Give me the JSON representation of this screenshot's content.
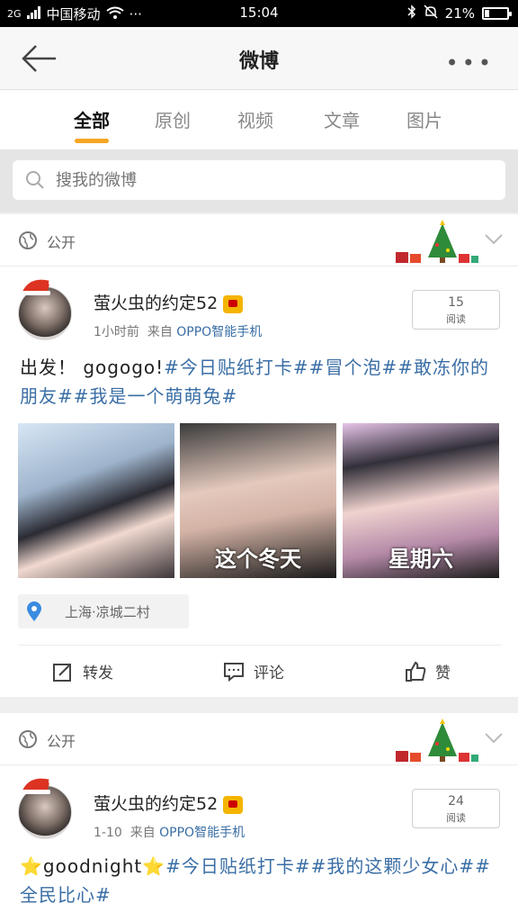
{
  "statusbar": {
    "carrier": "中国移动",
    "signal_label": "2G",
    "time": "15:04",
    "battery": "21%"
  },
  "header": {
    "title": "微博"
  },
  "tabs": [
    {
      "label": "全部",
      "active": true
    },
    {
      "label": "原创"
    },
    {
      "label": "视频"
    },
    {
      "label": "文章"
    },
    {
      "label": "图片"
    }
  ],
  "search": {
    "placeholder": "搜我的微博"
  },
  "posts": [
    {
      "privacy": "公开",
      "username": "萤火虫的约定52",
      "time": "1小时前",
      "source_prefix": "来自",
      "source": "OPPO智能手机",
      "reads_count": "15",
      "reads_label": "阅读",
      "text_plain": "出发！ gogogo!",
      "text_tags": "#今日贴纸打卡##冒个泡##敢冻你的朋友##我是一个萌萌兔#",
      "photos": [
        {
          "caption": ""
        },
        {
          "caption": "这个冬天"
        },
        {
          "caption": "星期六"
        }
      ],
      "location": "上海·凉城二村",
      "actions": {
        "repost": "转发",
        "comment": "评论",
        "like": "赞"
      }
    },
    {
      "privacy": "公开",
      "username": "萤火虫的约定52",
      "time": "1-10",
      "source_prefix": "来自",
      "source": "OPPO智能手机",
      "reads_count": "24",
      "reads_label": "阅读",
      "text_plain": "⭐goodnight⭐",
      "text_tags": "#今日贴纸打卡##我的这颗少女心##全民比心#"
    }
  ],
  "colors": {
    "accent": "#f5a623",
    "link": "#3a6ea5"
  }
}
